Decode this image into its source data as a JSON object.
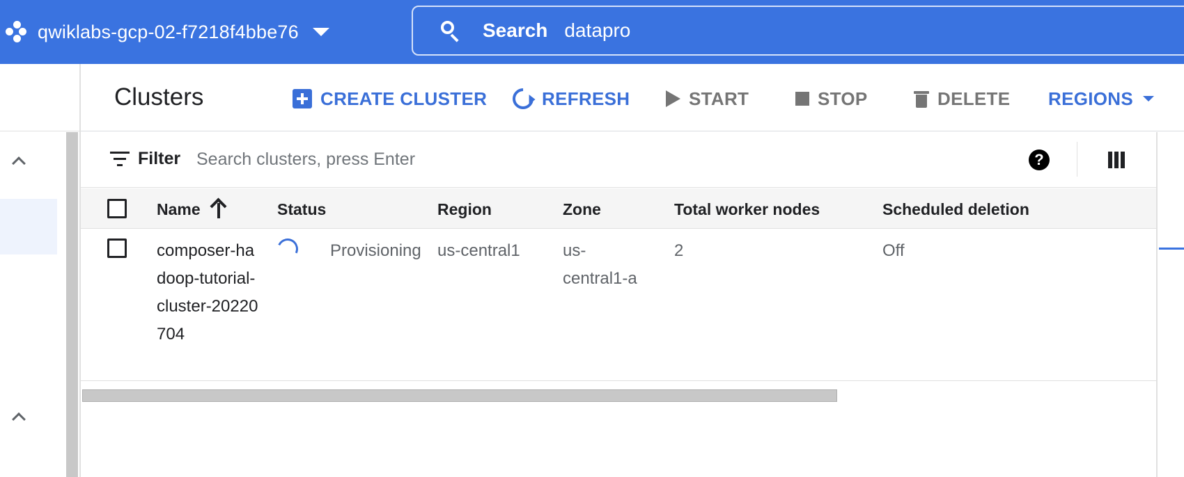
{
  "topbar": {
    "project_name": "qwiklabs-gcp-02-f7218f4bbe76",
    "search_label": "Search",
    "search_query": "datapro"
  },
  "header": {
    "title": "Clusters",
    "actions": {
      "create": "CREATE CLUSTER",
      "refresh": "REFRESH",
      "start": "START",
      "stop": "STOP",
      "delete": "DELETE",
      "regions": "REGIONS"
    }
  },
  "filter": {
    "label": "Filter",
    "placeholder": "Search clusters, press Enter"
  },
  "table": {
    "columns": {
      "name": "Name",
      "status": "Status",
      "region": "Region",
      "zone": "Zone",
      "workers": "Total worker nodes",
      "deletion": "Scheduled deletion"
    },
    "rows": [
      {
        "name": "composer-hadoop-tutorial-cluster-20220704",
        "status": "Provisioning",
        "region": "us-central1",
        "zone": "us-central1-a",
        "workers": "2",
        "deletion": "Off"
      }
    ]
  },
  "colors": {
    "brand_blue": "#3a73e0",
    "action_blue": "#3a6fd8",
    "disabled_grey": "#757575"
  },
  "icons": {
    "project": "project-hexagon-icon",
    "search": "search-icon",
    "create": "add-box-icon",
    "refresh": "refresh-icon",
    "start": "play-icon",
    "stop": "stop-icon",
    "delete": "trash-icon",
    "filter": "filter-icon",
    "help": "help-icon",
    "columns": "column-display-icon",
    "sort": "arrow-up-icon",
    "status": "spinner-icon"
  }
}
